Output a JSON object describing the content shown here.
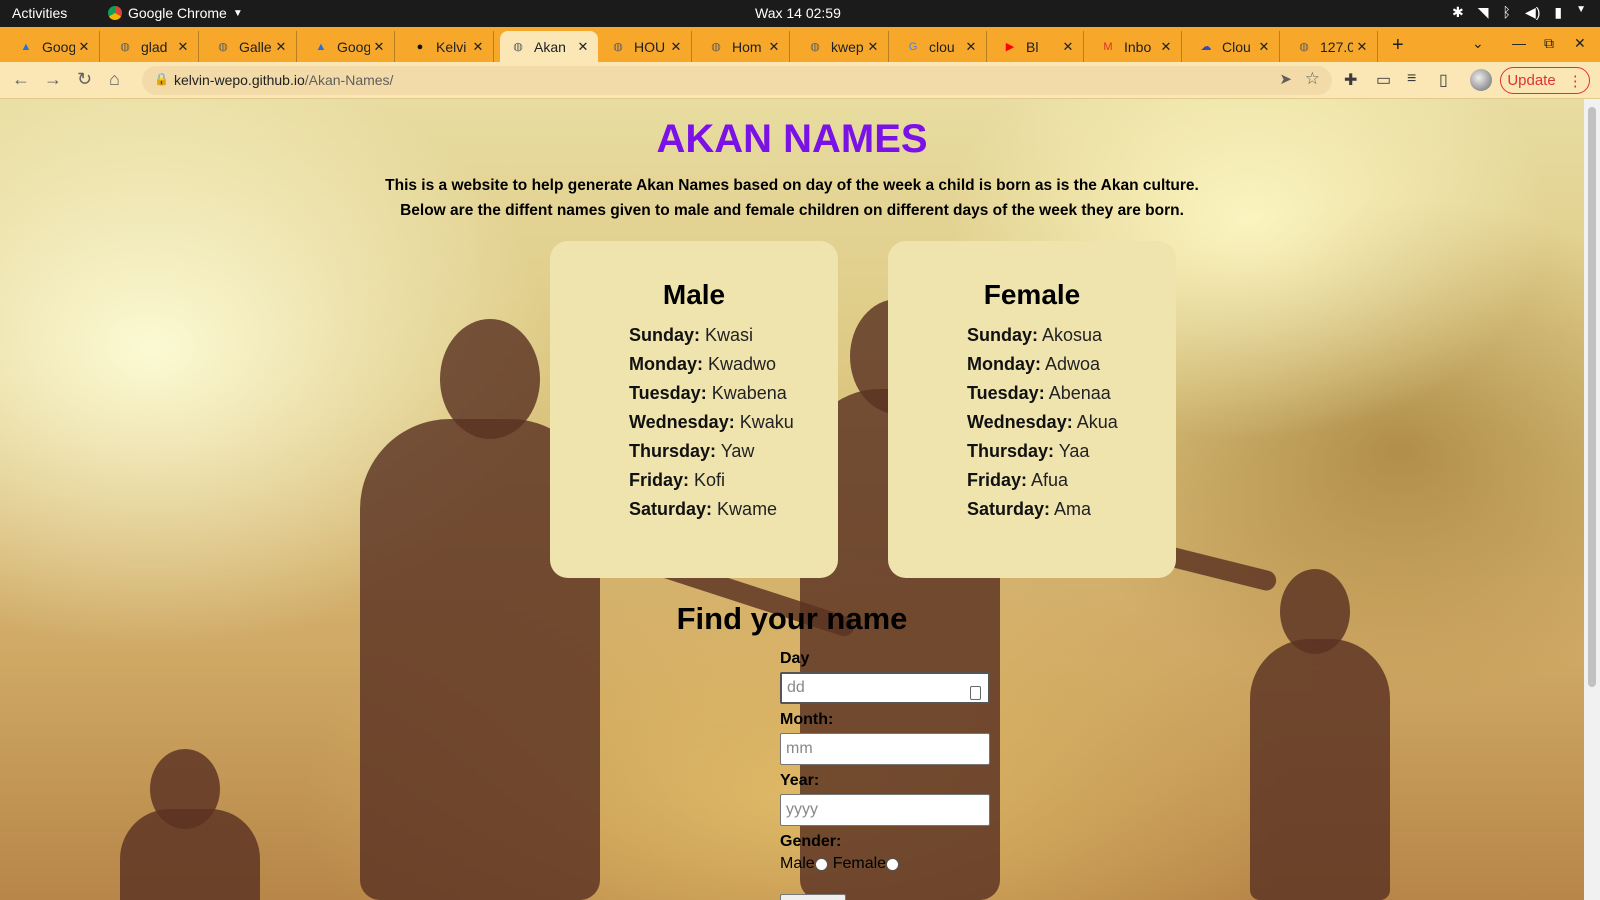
{
  "os_bar": {
    "activities": "Activities",
    "app_name": "Google Chrome",
    "clock": "Wax 14  02:59"
  },
  "tabs": [
    {
      "title": "Goog",
      "icon": "google-drive-icon",
      "icon_color": "#1a73e8"
    },
    {
      "title": "glad",
      "icon": "globe-icon",
      "icon_color": "#5f5f5f"
    },
    {
      "title": "Galle",
      "icon": "globe-icon",
      "icon_color": "#5f5f5f"
    },
    {
      "title": "Goog",
      "icon": "google-drive-icon",
      "icon_color": "#1a73e8"
    },
    {
      "title": "Kelvi",
      "icon": "github-icon",
      "icon_color": "#111111"
    },
    {
      "title": "Akan",
      "icon": "globe-icon",
      "icon_color": "#5f5f5f",
      "active": true
    },
    {
      "title": "HOU",
      "icon": "globe-icon",
      "icon_color": "#5f5f5f"
    },
    {
      "title": "Hom",
      "icon": "globe-icon",
      "icon_color": "#5f5f5f"
    },
    {
      "title": "kwep",
      "icon": "globe-icon",
      "icon_color": "#5f5f5f"
    },
    {
      "title": "clou",
      "icon": "google-icon",
      "icon_color": "#4285f4"
    },
    {
      "title": "Bl",
      "icon": "youtube-icon",
      "icon_color": "#ff0000"
    },
    {
      "title": "Inbo",
      "icon": "gmail-icon",
      "icon_color": "#d93025"
    },
    {
      "title": "Clou",
      "icon": "cloudinary-icon",
      "icon_color": "#3448c5"
    },
    {
      "title": "127.0",
      "icon": "globe-icon",
      "icon_color": "#5f5f5f"
    }
  ],
  "address_bar": {
    "domain": "kelvin-wepo.github.io",
    "path": "/Akan-Names/"
  },
  "update_button": "Update",
  "page": {
    "title": "AKAN NAMES",
    "intro_line1": "This is a website to help generate Akan Names based on day of the week a child is born as is the Akan culture.",
    "intro_line2": "Below are the diffent names given to male and female children on different days of the week they are born.",
    "male_card": {
      "heading": "Male",
      "entries": [
        {
          "day": "Sunday:",
          "name": "Kwasi"
        },
        {
          "day": "Monday:",
          "name": "Kwadwo"
        },
        {
          "day": "Tuesday:",
          "name": "Kwabena"
        },
        {
          "day": "Wednesday:",
          "name": "Kwaku"
        },
        {
          "day": "Thursday:",
          "name": "Yaw"
        },
        {
          "day": "Friday:",
          "name": "Kofi"
        },
        {
          "day": "Saturday:",
          "name": "Kwame"
        }
      ]
    },
    "female_card": {
      "heading": "Female",
      "entries": [
        {
          "day": "Sunday:",
          "name": "Akosua"
        },
        {
          "day": "Monday:",
          "name": "Adwoa"
        },
        {
          "day": "Tuesday:",
          "name": "Abenaa"
        },
        {
          "day": "Wednesday:",
          "name": "Akua"
        },
        {
          "day": "Thursday:",
          "name": "Yaa"
        },
        {
          "day": "Friday:",
          "name": "Afua"
        },
        {
          "day": "Saturday:",
          "name": "Ama"
        }
      ]
    },
    "form": {
      "title": "Find your name",
      "day_label": "Day",
      "day_placeholder": "dd",
      "month_label": "Month:",
      "month_placeholder": "mm",
      "year_label": "Year:",
      "year_placeholder": "yyyy",
      "gender_label": "Gender:",
      "gender_male": "Male",
      "gender_female": "Female"
    }
  },
  "colors": {
    "tab_strip": "#f7a82a",
    "toolbar": "#fbe7b6",
    "title": "#7a11e6",
    "card": "#f0e4ae",
    "update": "#dd3333"
  }
}
